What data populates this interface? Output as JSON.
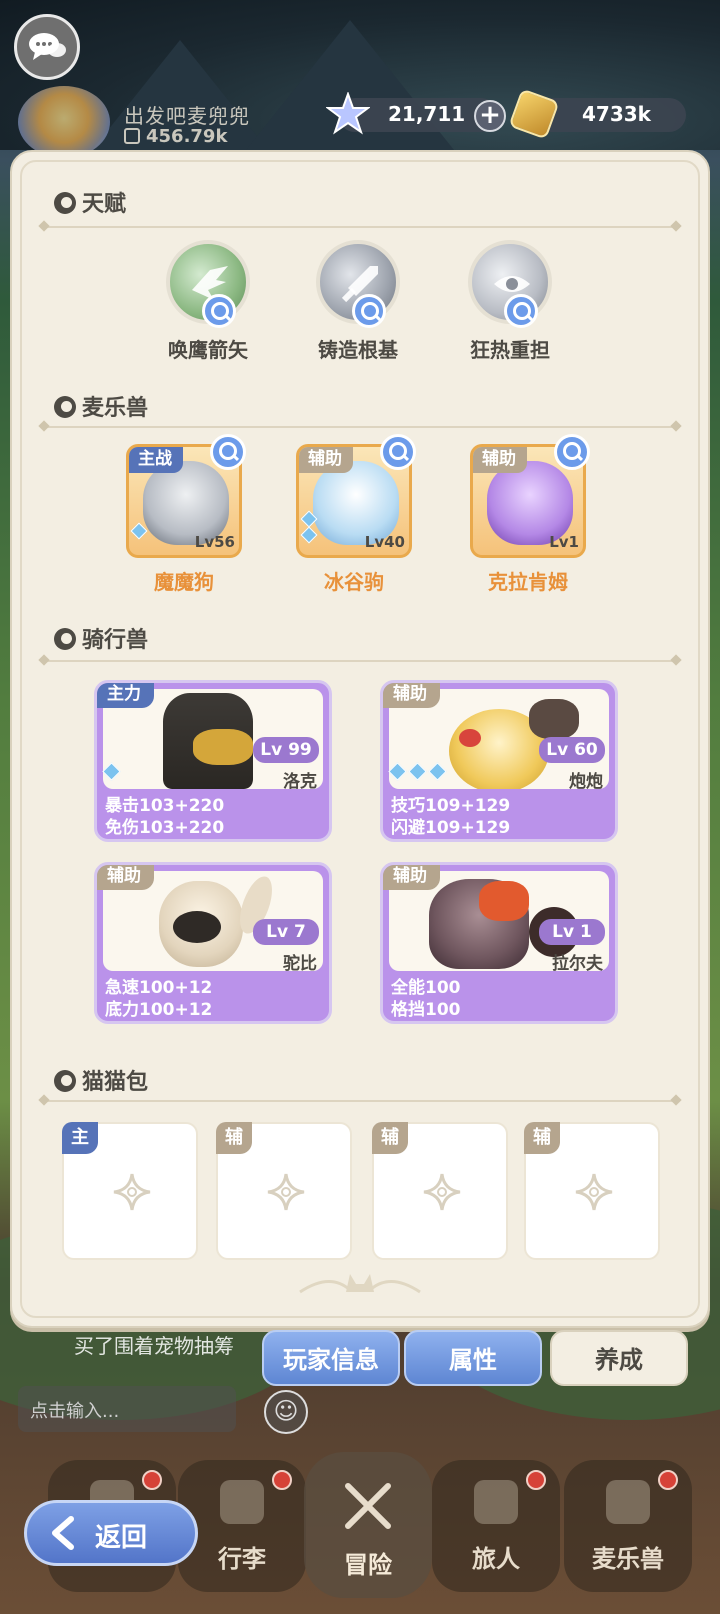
{
  "header": {
    "player_name": "出发吧麦兜兜",
    "player_power": "456.79k",
    "star_currency": "21,711",
    "coin_currency": "4733k"
  },
  "sections": {
    "talent": "天赋",
    "pets": "麦乐兽",
    "mounts": "骑行兽",
    "cat_bag": "猫猫包"
  },
  "talents": [
    {
      "label": "唤鹰箭矢",
      "icon": "eagle-icon"
    },
    {
      "label": "铸造根基",
      "icon": "sword-icon"
    },
    {
      "label": "狂热重担",
      "icon": "eye-icon"
    }
  ],
  "pets": [
    {
      "role": "主战",
      "name": "魔魔狗",
      "level": "Lv56",
      "color": "#cfd2d8"
    },
    {
      "role": "辅助",
      "name": "冰谷驹",
      "level": "Lv40",
      "color": "#a9d6f2"
    },
    {
      "role": "辅助",
      "name": "克拉肯姆",
      "level": "Lv1",
      "color": "#b488e6"
    }
  ],
  "mounts": [
    {
      "role": "主力",
      "level": "Lv 99",
      "name": "洛克",
      "stat1": "暴击103+220",
      "stat2": "免伤103+220"
    },
    {
      "role": "辅助",
      "level": "Lv 60",
      "name": "炮炮",
      "stat1": "技巧109+129",
      "stat2": "闪避109+129"
    },
    {
      "role": "辅助",
      "level": "Lv 7",
      "name": "驼比",
      "stat1": "急速100+12",
      "stat2": "底力100+12"
    },
    {
      "role": "辅助",
      "level": "Lv 1",
      "name": "拉尔夫",
      "stat1": "全能100",
      "stat2": "格挡100"
    }
  ],
  "cat_bags": [
    {
      "role": "主"
    },
    {
      "role": "辅"
    },
    {
      "role": "辅"
    },
    {
      "role": "辅"
    }
  ],
  "chat": {
    "message": "买了围着宠物抽筹",
    "input_placeholder": "点击输入..."
  },
  "tabs": [
    "玩家信息",
    "属性",
    "养成"
  ],
  "nav": [
    "行李",
    "冒险",
    "旅人",
    "麦乐兽"
  ],
  "back_label": "返回",
  "colors": {
    "accent_blue": "#5e86d3",
    "mount_purple": "#ba92ea",
    "pet_name_orange": "#e8913a",
    "panel_bg": "#f3eee2"
  }
}
